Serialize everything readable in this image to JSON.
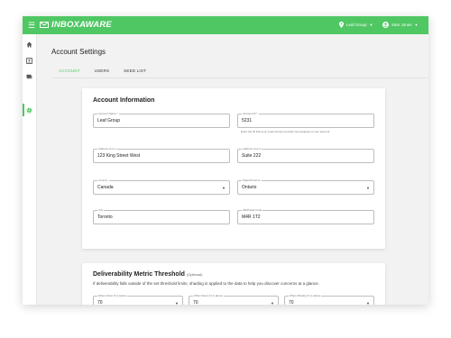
{
  "app": {
    "brand": "INBOXAWARE",
    "org_selector": "Leaf Group",
    "user_selector": "Sam Jones"
  },
  "icons": {
    "menu": "hamburger-icon",
    "logo": "envelope-wave-icon",
    "org": "location-pin-icon",
    "user": "account-circle-icon",
    "sidebar": [
      "home-icon",
      "contact-card-icon",
      "messages-icon",
      "gear-icon"
    ]
  },
  "colors": {
    "accent": "#4fc763",
    "background": "#f2f2f2"
  },
  "page": {
    "title": "Account Settings",
    "tabs": [
      "ACCOUNT",
      "USERS",
      "SEED LIST"
    ],
    "active_tab": "ACCOUNT"
  },
  "account_info": {
    "title": "Account Information",
    "account_name_label": "Account Name *",
    "account_name": "Leaf Group",
    "account_id_label": "Account ID *",
    "account_id": "5231",
    "account_id_helper": "Enter the ID that your email service provider has assigned to your account",
    "address1_label": "Address Line 1",
    "address1": "123 King Street West",
    "address2_label": "Address Line 2",
    "address2": "Suite 222",
    "country_label": "Country",
    "country": "Canada",
    "state_label": "State/Province",
    "state": "Ontario",
    "city_label": "City",
    "city": "Toronto",
    "zip_label": "Zip/Postal Code",
    "zip": "M4R 1T2"
  },
  "threshold": {
    "title": "Deliverability Metric Threshold",
    "optional": "(Optional)",
    "description": "If deliverability falls outside of the set threshold limits, shading is applied to the data to help you discover concerns at a glance.",
    "inbox_label": "When Inbox % is below",
    "inbox_value": "70",
    "spam_label": "When Spam % is above",
    "spam_value": "70",
    "missing_label": "When Missing % is above",
    "missing_value": "70"
  }
}
